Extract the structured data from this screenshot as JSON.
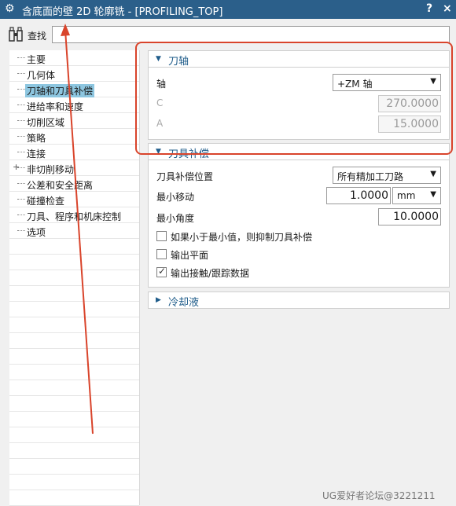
{
  "window": {
    "title": "含底面的壁 2D 轮廓铣 - [PROFILING_TOP]",
    "help_label": "?",
    "close_label": "×"
  },
  "find": {
    "label": "查找",
    "value": ""
  },
  "tree": {
    "items": [
      {
        "label": "主要",
        "expander": ""
      },
      {
        "label": "几何体",
        "expander": ""
      },
      {
        "label": "刀轴和刀具补偿",
        "expander": "",
        "selected": true
      },
      {
        "label": "进给率和速度",
        "expander": ""
      },
      {
        "label": "切削区域",
        "expander": ""
      },
      {
        "label": "策略",
        "expander": ""
      },
      {
        "label": "连接",
        "expander": ""
      },
      {
        "label": "非切削移动",
        "expander": "+"
      },
      {
        "label": "公差和安全距离",
        "expander": ""
      },
      {
        "label": "碰撞检查",
        "expander": ""
      },
      {
        "label": "刀具、程序和机床控制",
        "expander": ""
      },
      {
        "label": "选项",
        "expander": ""
      }
    ]
  },
  "tool_axis": {
    "title": "刀轴",
    "axis_label": "轴",
    "axis_value": "+ZM 轴",
    "c_label": "C",
    "c_value": "270.0000",
    "a_label": "A",
    "a_value": "15.0000"
  },
  "tool_comp": {
    "title": "刀具补偿",
    "position_label": "刀具补偿位置",
    "position_value": "所有精加工刀路",
    "min_move_label": "最小移动",
    "min_move_value": "1.0000",
    "min_move_unit": "mm",
    "min_angle_label": "最小角度",
    "min_angle_value": "10.0000",
    "suppress_label": "如果小于最小值，则抑制刀具补偿",
    "suppress_checked": false,
    "output_plane_label": "输出平面",
    "output_plane_checked": false,
    "output_contact_label": "输出接触/跟踪数据",
    "output_contact_checked": true
  },
  "coolant": {
    "title": "冷却液"
  },
  "watermark": "UG爱好者论坛@3221211",
  "colors": {
    "titlebar": "#2b5f8a",
    "section_title": "#1f5c8a",
    "selection": "#8dc6e0",
    "annotation": "#d9442b"
  }
}
